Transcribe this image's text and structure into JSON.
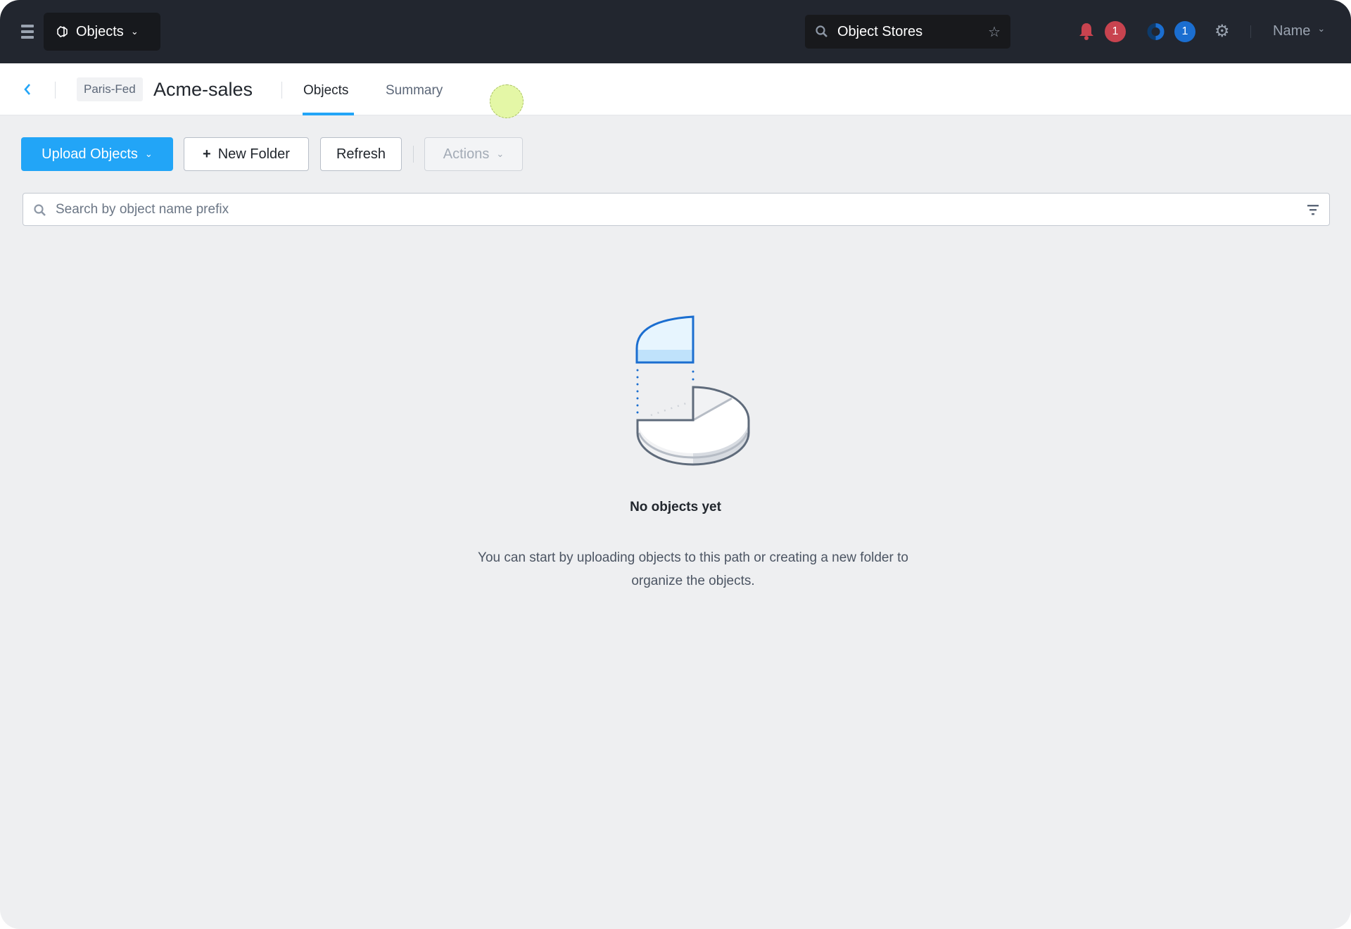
{
  "topbar": {
    "app_label": "Objects",
    "search_value": "Object Stores",
    "alerts_count": "1",
    "tasks_count": "1",
    "user_label": "Name"
  },
  "header": {
    "cluster_tag": "Paris-Fed",
    "bucket_name": "Acme-sales",
    "tabs": [
      {
        "label": "Objects",
        "active": true
      },
      {
        "label": "Summary",
        "active": false
      }
    ]
  },
  "toolbar": {
    "upload_label": "Upload Objects",
    "new_folder_label": "New Folder",
    "refresh_label": "Refresh",
    "actions_label": "Actions"
  },
  "search": {
    "placeholder": "Search by object name prefix"
  },
  "empty_state": {
    "title": "No objects yet",
    "description": "You can start by uploading objects to this path or creating a new folder to organize the objects."
  },
  "colors": {
    "primary": "#22a5f7",
    "topbar": "#22262f",
    "alert": "#c8434f",
    "task": "#1b6ed0"
  }
}
